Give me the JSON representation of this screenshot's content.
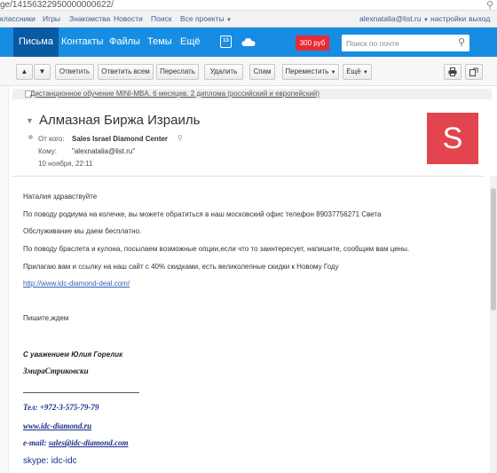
{
  "url": "ge/14156322950000000622/",
  "portal_links": [
    "классники",
    "Игры",
    "Знакомства",
    "Новости",
    "Поиск",
    "Все проекты"
  ],
  "user_email": "alexnatalia@list.ru",
  "portal_right": [
    "настройки",
    "выход"
  ],
  "nav": [
    "Письма",
    "Контакты",
    "Файлы",
    "Темы",
    "Ещё"
  ],
  "calendar_day": "13",
  "balance": "300 руб",
  "search_placeholder": "Поиск по почте",
  "toolbar": [
    "Ответить",
    "Ответить всем",
    "Переслать",
    "Удалить",
    "Спам",
    "Переместить",
    "Ещё"
  ],
  "thread_preview": "Дистанционное обучение MINI-MBA. 6 месяцев. 2 диплома (российский и европейский)",
  "email": {
    "subject": "Алмазная Биржа Израиль",
    "from_label": "От кого:",
    "from_name": "Sales Israel Diamond Center",
    "to_label": "Кому:",
    "to_value": "\"alexnatalia@list.ru\"",
    "date": "10 ноября, 22:11",
    "avatar_letter": "S",
    "avatar_color": "#e3454e"
  },
  "body": {
    "greeting": "Наталия здравствуйте",
    "p1": "По поводу родиума на колечке, вы можете обратиться в наш московский офис телефон 89037756271 Света",
    "p2": "Обслуживание мы даем бесплатно.",
    "p3": "По поводу браслета и кулона, посылаем возможные опции,если что то заинтересует, напишите, сообщим вам цены.",
    "p4": "Прилагаю вам и ссылку на наш сайт с 40% скидками, есть великолепные скидки к Новому Году",
    "link": "http://www.idc-diamond-deal.com/",
    "closing": "Пишите,ждем"
  },
  "signature": {
    "regards": "С уважением Юлия Горелик",
    "name": "ЗмираСтриковски",
    "phone": "Тел: +972-3-575-79-79",
    "site": "www.idc-diamond.ru",
    "email_label": "e-mail:",
    "email": "sales@idc-diamond.com",
    "skype": "skype: idc-idc"
  },
  "colors": {
    "brand_blue": "#168de2",
    "active_nav": "#0a5aa3",
    "balance_red": "#e82b35",
    "signature_blue": "#1a2f8a"
  }
}
